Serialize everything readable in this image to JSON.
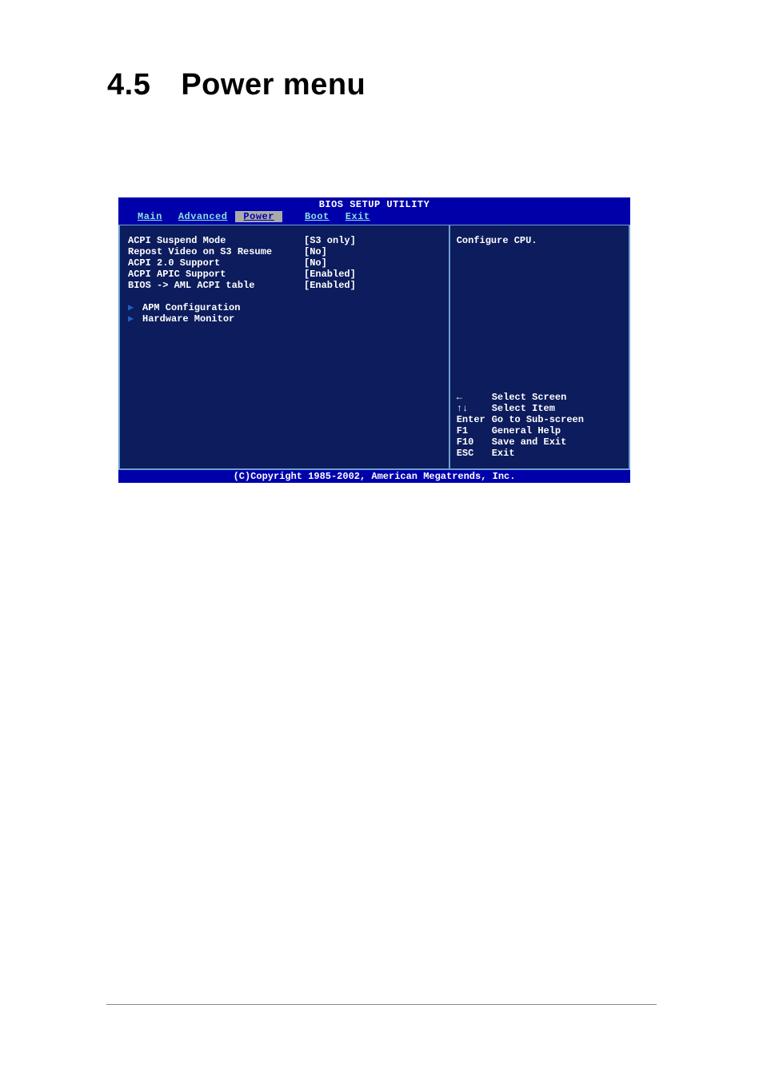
{
  "heading": {
    "section_num": "4.5",
    "title": "Power menu"
  },
  "bios": {
    "title": "BIOS SETUP UTILITY",
    "tabs": [
      "Main",
      "Advanced",
      "Power",
      "Boot",
      "Exit"
    ],
    "selected_tab": "Power",
    "settings": [
      {
        "label": "ACPI Suspend Mode",
        "value": "[S3 only]"
      },
      {
        "label": "Repost Video on S3 Resume",
        "value": "[No]"
      },
      {
        "label": "ACPI 2.0 Support",
        "value": "[No]"
      },
      {
        "label": "ACPI APIC Support",
        "value": "[Enabled]"
      },
      {
        "label": "BIOS -> AML ACPI table",
        "value": "[Enabled]"
      }
    ],
    "submenus": [
      {
        "label": "APM Configuration"
      },
      {
        "label": "Hardware Monitor"
      }
    ],
    "help_text": "Configure CPU.",
    "nav": [
      {
        "key": "←",
        "desc": "Select Screen"
      },
      {
        "key": "↑↓",
        "desc": "Select Item"
      },
      {
        "key": "Enter",
        "desc": "Go to Sub-screen"
      },
      {
        "key": "F1",
        "desc": "General Help"
      },
      {
        "key": "F10",
        "desc": "Save and Exit"
      },
      {
        "key": "ESC",
        "desc": "Exit"
      }
    ],
    "footer": "(C)Copyright 1985-2002, American Megatrends, Inc."
  }
}
